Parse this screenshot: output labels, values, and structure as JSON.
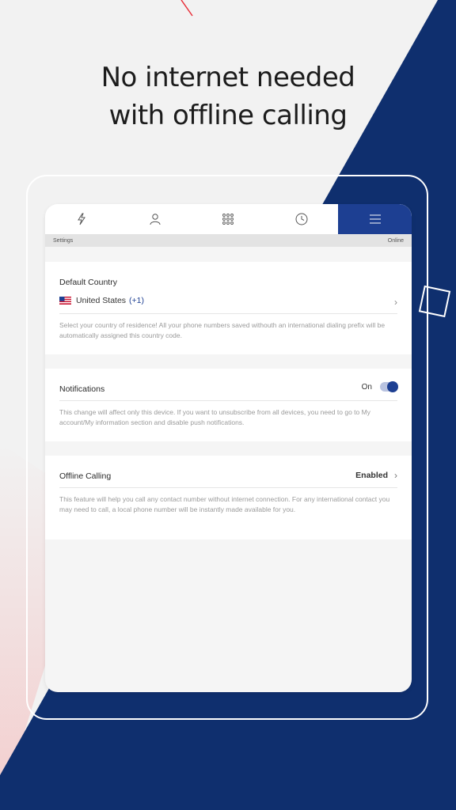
{
  "headline": {
    "line1": "No internet needed",
    "line2": "with offline calling"
  },
  "colors": {
    "brand_blue": "#1d3f92",
    "background": "#f2f2f2",
    "accent_red": "#e8303a"
  },
  "tabs": [
    {
      "icon": "lightning-icon",
      "active": false
    },
    {
      "icon": "contact-icon",
      "active": false
    },
    {
      "icon": "dialpad-icon",
      "active": false
    },
    {
      "icon": "clock-icon",
      "active": false
    },
    {
      "icon": "menu-icon",
      "active": true
    }
  ],
  "status": {
    "left": "Settings",
    "right": "Online"
  },
  "default_country": {
    "title": "Default Country",
    "country_name": "United States",
    "country_code": "(+1)",
    "description": "Select your country of residence! All your phone numbers saved withouth an international dialing prefix will be automatically assigned this country code."
  },
  "notifications": {
    "title": "Notifications",
    "state_label": "On",
    "description": "This change will affect only this device. If you want to unsubscribe from all devices, you need to go to My account/My information section and disable push notifications."
  },
  "offline_calling": {
    "title": "Offline Calling",
    "value": "Enabled",
    "description": "This feature will help you call any contact number without internet connection. For any international contact you may need to call, a local phone number will be instantly made available for you."
  }
}
